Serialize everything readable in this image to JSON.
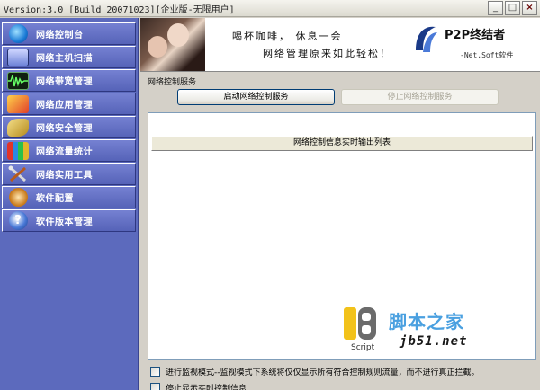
{
  "window": {
    "title": "Version:3.0 [Build 20071023][企业版-无限用户]",
    "minimize": "_",
    "maximize": "□",
    "close": "×"
  },
  "sidebar": {
    "items": [
      {
        "label": "网络控制台",
        "icon": "globe-icon"
      },
      {
        "label": "网络主机扫描",
        "icon": "host-scan-icon"
      },
      {
        "label": "网络带宽管理",
        "icon": "bandwidth-wave-icon"
      },
      {
        "label": "网络应用管理",
        "icon": "application-icon"
      },
      {
        "label": "网络安全管理",
        "icon": "key-icon"
      },
      {
        "label": "网络流量统计",
        "icon": "statistics-icon"
      },
      {
        "label": "网络实用工具",
        "icon": "tools-icon"
      },
      {
        "label": "软件配置",
        "icon": "settings-icon"
      },
      {
        "label": "软件版本管理",
        "icon": "help-icon"
      }
    ]
  },
  "banner": {
    "slogan_line1": "喝杯咖啡，  休息一会",
    "slogan_line2": "网络管理原来如此轻松！",
    "brand_name": "P2P终结者",
    "brand_sub": "-Net.Soft软件"
  },
  "service": {
    "section_title": "网络控制服务",
    "start_button": "启动网络控制服务",
    "stop_button": "停止网络控制服务",
    "log_header": "网络控制信息实时输出列表"
  },
  "watermark": {
    "cn": "脚本之家",
    "url": "jb51.net",
    "script": "Script"
  },
  "options": {
    "monitor_mode": "进行监视模式--监视模式下系统将仅仅显示所有符合控制规则流量，而不进行真正拦截。",
    "show_realtime": "停止显示实时控制信息"
  }
}
